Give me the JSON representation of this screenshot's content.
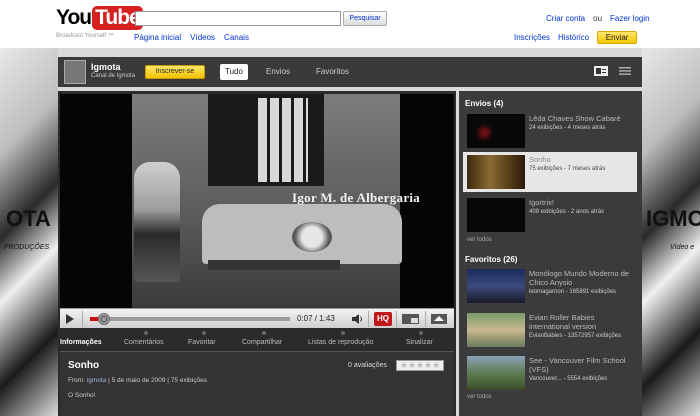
{
  "header": {
    "logo_you": "You",
    "logo_tube": "Tube",
    "tagline": "Broadcast Yourself ™",
    "search_value": "",
    "search_button": "Pesquisar",
    "nav": [
      "Página inicial",
      "Vídeos",
      "Canais"
    ],
    "create_account": "Criar conta",
    "or": "ou",
    "login": "Fazer login",
    "subscriptions": "Inscrições",
    "history": "Histórico",
    "upload": "Enviar"
  },
  "background": {
    "left_text": "OTA",
    "left_sub": "PRODUÇÕES",
    "right_text": "IGMO",
    "right_sub": "Vídeo e"
  },
  "channel": {
    "name": "Igmota",
    "subtitle": "Canal de Igmota",
    "subscribe": "Inscrever-se",
    "tabs": [
      "Tudo",
      "Envios",
      "Favoritos"
    ],
    "active_tab": "Tudo"
  },
  "player": {
    "overlay_text": "Igor M. de Albergaria",
    "time": "0:07 / 1:43",
    "progress": 0.068,
    "hq": "HQ"
  },
  "info_tabs": [
    "Informações",
    "Comentários",
    "Favoritar",
    "Compartilhar",
    "Listas de reprodução",
    "Sinalizar"
  ],
  "video_info": {
    "title": "Sonho",
    "ratings": "0 avaliações",
    "from_label": "From:",
    "from_user": "igmota",
    "date": "5 de maio de 2009",
    "views": "75 exibições",
    "description": "O Sonho!"
  },
  "sidebar": {
    "uploads_title": "Envios (4)",
    "uploads": [
      {
        "title": "Lêda Chaves Show Cabaré",
        "meta": "24 exibições - 4 meses atrás"
      },
      {
        "title": "Sonho",
        "meta": "75 exibições - 7 meses atrás"
      },
      {
        "title": "Igortrix!",
        "meta": "409 exibições - 2 anos atrás"
      }
    ],
    "see_all_1": "ver todos",
    "favorites_title": "Favoritos (26)",
    "favorites": [
      {
        "title": "Monólogo Mundo Moderno de Chico Anysio",
        "meta": "leomagarnon - 165891 exibições"
      },
      {
        "title": "Evian Roller Babies international version",
        "meta": "EvianBabies - 13572957 exibições"
      },
      {
        "title": "See - Vancouver Film School (VFS)",
        "meta": "Vancouver... - 5554 exibições"
      }
    ],
    "see_all_2": "ver todos"
  },
  "colors": {
    "youtube_red": "#d62020",
    "link_blue": "#0033cc",
    "upload_yellow": "#f5c800",
    "hq_red": "#c01818"
  }
}
